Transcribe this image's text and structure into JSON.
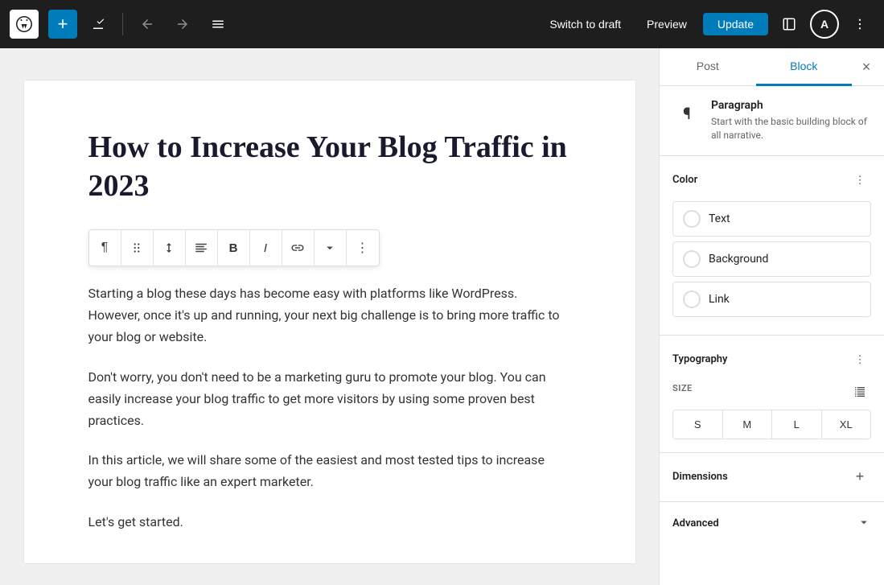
{
  "topbar": {
    "add_label": "+",
    "wp_logo_title": "WordPress",
    "undo_label": "↩",
    "redo_label": "↪",
    "list_view_label": "≡",
    "switch_to_draft": "Switch to draft",
    "preview": "Preview",
    "update": "Update"
  },
  "sidebar": {
    "tab_post": "Post",
    "tab_block": "Block",
    "block_name": "Paragraph",
    "block_description": "Start with the basic building block of all narrative.",
    "color_section_title": "Color",
    "color_options": [
      {
        "label": "Text"
      },
      {
        "label": "Background"
      },
      {
        "label": "Link"
      }
    ],
    "typography_title": "Typography",
    "size_label": "SIZE",
    "size_options": [
      "S",
      "M",
      "L",
      "XL"
    ],
    "dimensions_title": "Dimensions",
    "advanced_title": "Advanced"
  },
  "editor": {
    "title": "How to Increase Your Blog Traffic in 2023",
    "paragraphs": [
      "Starting a blog these days has become easy with platforms like WordPress. However, once it's up and running, your next big challenge is to bring more traffic to your blog or website.",
      "Don't worry, you don't need to be a marketing guru to promote your blog. You can easily increase your blog traffic to get more visitors by using some proven best practices.",
      "In this article, we will share some of the easiest and most tested tips to increase your blog traffic like an expert marketer.",
      "Let's get started."
    ]
  }
}
